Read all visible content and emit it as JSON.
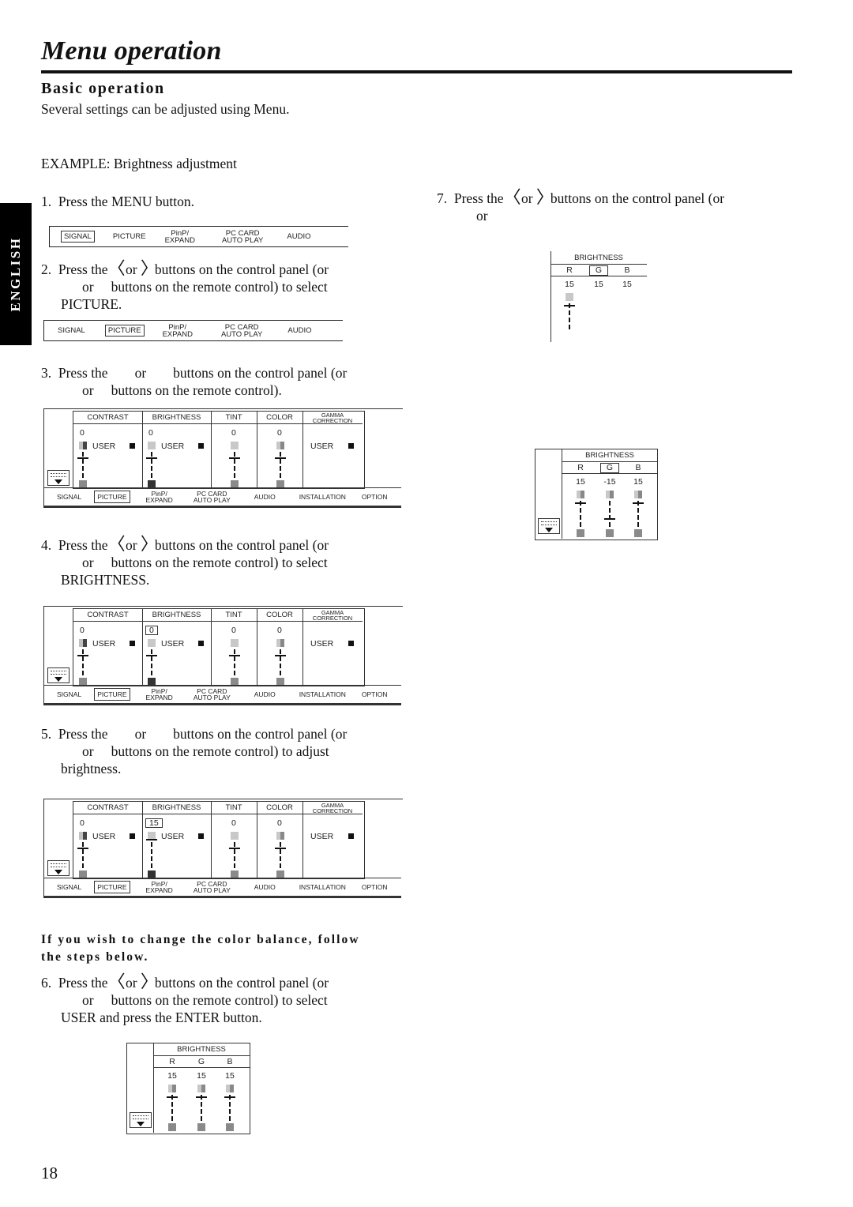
{
  "page": {
    "title": "Menu operation",
    "section_title": "Basic operation",
    "intro": "Several settings can be adjusted using Menu.",
    "example": "EXAMPLE: Brightness adjustment",
    "language_tab": "ENGLISH",
    "page_number": "18"
  },
  "icons": {
    "left": "chevron-left-icon",
    "right": "chevron-right-icon",
    "left_glyph": "〈",
    "right_glyph": "〉"
  },
  "steps": {
    "s1": {
      "num": "1.",
      "text": "Press the MENU button."
    },
    "s2": {
      "num": "2.",
      "a": "Press the",
      "or": "or",
      "b": "buttons on the control panel (or",
      "c": "or",
      "d": "buttons on the remote control) to select",
      "e": "PICTURE."
    },
    "s3": {
      "num": "3.",
      "a": "Press the",
      "or": "or",
      "b": "buttons on the control panel (or",
      "c": "or",
      "d": "buttons on the remote control)."
    },
    "s4": {
      "num": "4.",
      "a": "Press the",
      "or": "or",
      "b": "buttons on the control panel (or",
      "c": "or",
      "d": "buttons on the remote control) to select",
      "e": "BRIGHTNESS."
    },
    "s5": {
      "num": "5.",
      "a": "Press the",
      "or": "or",
      "b": "buttons on the control panel (or",
      "c": "or",
      "d": "buttons on the remote control) to adjust",
      "e": "brightness."
    },
    "note": {
      "line1": "If you wish to change the color balance, follow",
      "line2": "the steps below."
    },
    "s6": {
      "num": "6.",
      "a": "Press the",
      "or": "or",
      "b": "buttons on the control panel (or",
      "c": "or",
      "d": "buttons on the remote control) to select",
      "e": "USER and press the ENTER button."
    },
    "s7": {
      "num": "7.",
      "a": "Press the",
      "or": "or",
      "b": "buttons on the control panel (or",
      "c": "or"
    }
  },
  "menubar": {
    "items": [
      "SIGNAL",
      "PICTURE",
      "PinP/",
      "EXPAND",
      "PC CARD",
      "AUTO PLAY",
      "AUDIO"
    ],
    "selected_step1": "SIGNAL",
    "selected_step2": "PICTURE"
  },
  "picture_menu": {
    "columns": {
      "contrast": "CONTRAST",
      "brightness": "BRIGHTNESS",
      "tint": "TINT",
      "color": "COLOR",
      "gamma1": "GAMMA",
      "gamma2": "CORRECTION"
    },
    "user_label": "USER",
    "tabs": [
      "SIGNAL",
      "PICTURE",
      "PinP/",
      "EXPAND",
      "PC CARD",
      "AUTO PLAY",
      "AUDIO",
      "INSTALLATION",
      "OPTION"
    ],
    "selected_tab": "PICTURE",
    "panels": [
      {
        "contrast": "0",
        "brightness": "0",
        "tint": "0",
        "color": "0",
        "brightness_selected": false
      },
      {
        "contrast": "0",
        "brightness": "0",
        "tint": "0",
        "color": "0",
        "brightness_selected": true
      },
      {
        "contrast": "0",
        "brightness": "15",
        "tint": "0",
        "color": "0",
        "brightness_selected": true
      }
    ]
  },
  "rgb_menu": {
    "title": "BRIGHTNESS",
    "labels": [
      "R",
      "G",
      "B"
    ],
    "step6": {
      "values": [
        "15",
        "15",
        "15"
      ],
      "selected": ""
    },
    "step7a": {
      "values": [
        "15",
        "15",
        "15"
      ],
      "selected": "G"
    },
    "step7b": {
      "values": [
        "15",
        "-15",
        "15"
      ],
      "selected": "G"
    }
  }
}
